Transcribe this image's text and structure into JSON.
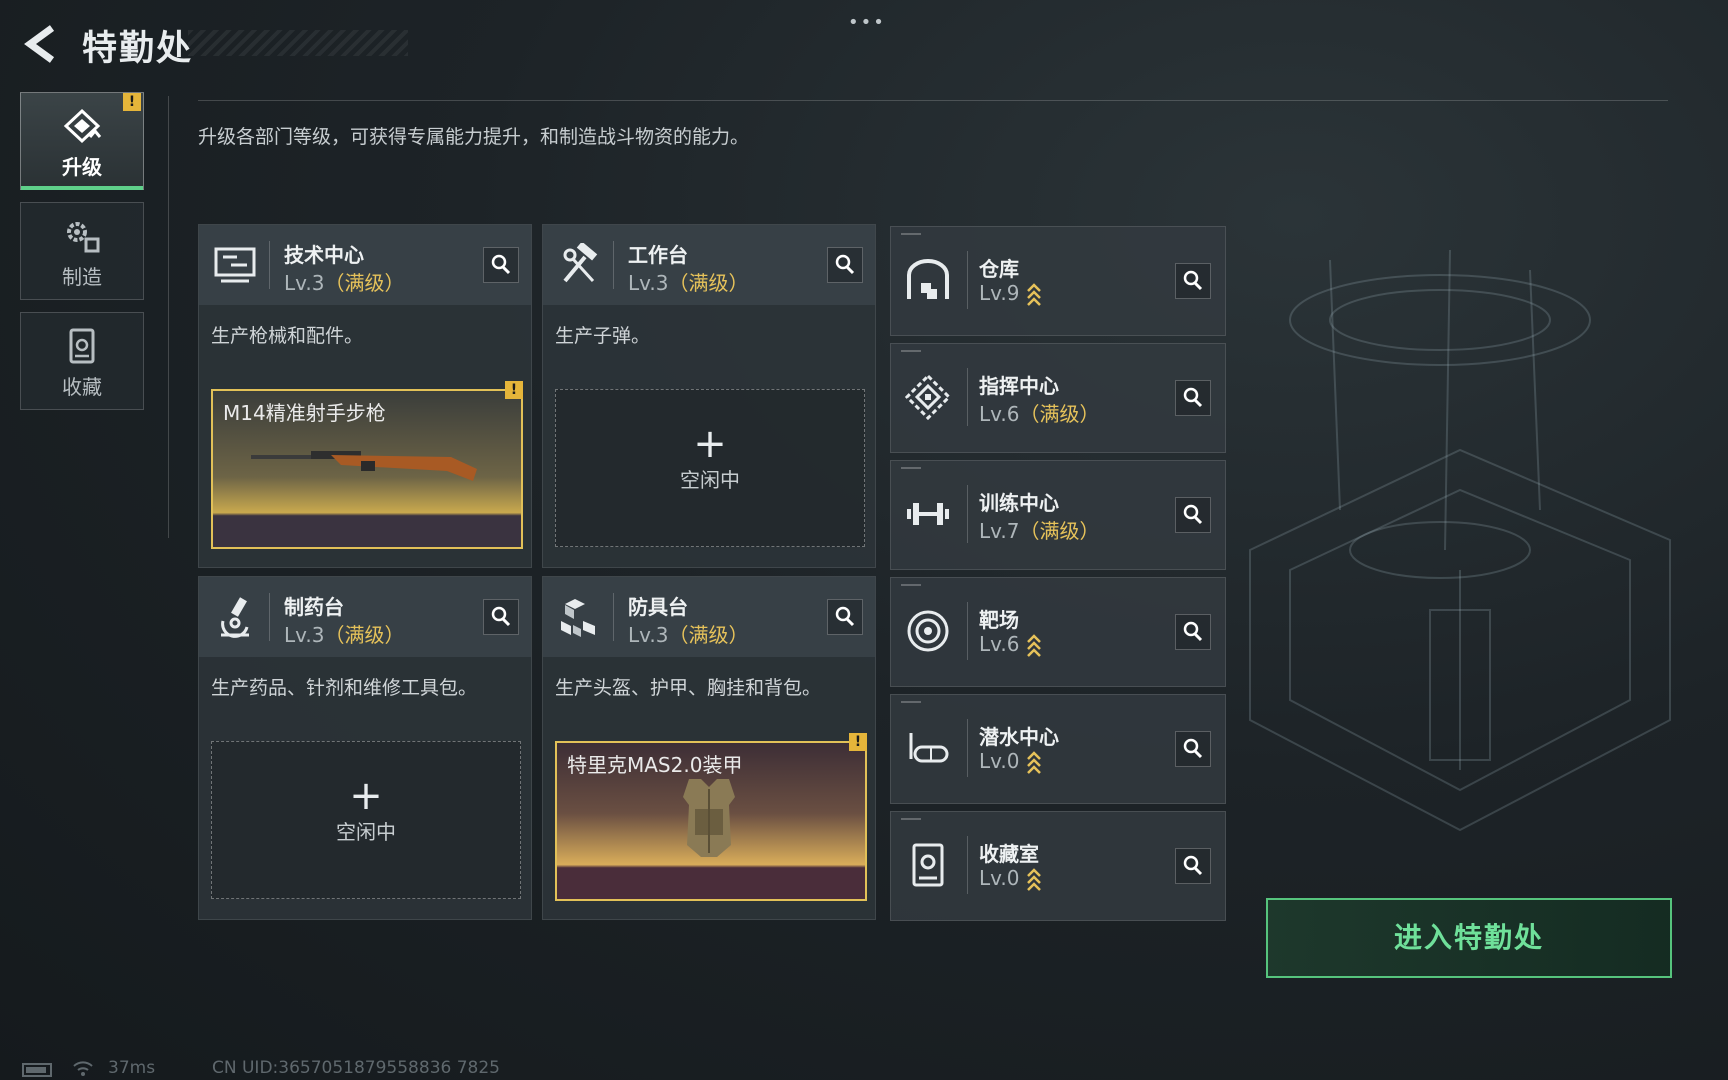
{
  "header": {
    "title": "特勤处",
    "more": "•••"
  },
  "description": "升级各部门等级，可获得专属能力提升，和制造战斗物资的能力。",
  "tabs": [
    {
      "label": "升级",
      "active": true,
      "badge": "!"
    },
    {
      "label": "制造",
      "active": false
    },
    {
      "label": "收藏",
      "active": false
    }
  ],
  "cards": [
    {
      "name": "技术中心",
      "level": "Lv.3",
      "max": "（满级）",
      "desc": "生产枪械和配件。",
      "slot": {
        "type": "item",
        "item_name": "M14精准射手步枪",
        "badge": "!"
      }
    },
    {
      "name": "工作台",
      "level": "Lv.3",
      "max": "（满级）",
      "desc": "生产子弹。",
      "slot": {
        "type": "empty",
        "plus": "+",
        "status": "空闲中"
      }
    },
    {
      "name": "制药台",
      "level": "Lv.3",
      "max": "（满级）",
      "desc": "生产药品、针剂和维修工具包。",
      "slot": {
        "type": "empty",
        "plus": "+",
        "status": "空闲中"
      }
    },
    {
      "name": "防具台",
      "level": "Lv.3",
      "max": "（满级）",
      "desc": "生产头盔、护甲、胸挂和背包。",
      "slot": {
        "type": "item",
        "item_name": "特里克MAS2.0装甲",
        "badge": "!"
      }
    }
  ],
  "facilities": [
    {
      "name": "仓库",
      "level": "Lv.9",
      "max": "",
      "upgradable": true
    },
    {
      "name": "指挥中心",
      "level": "Lv.6",
      "max": "（满级）",
      "upgradable": false
    },
    {
      "name": "训练中心",
      "level": "Lv.7",
      "max": "（满级）",
      "upgradable": false
    },
    {
      "name": "靶场",
      "level": "Lv.6",
      "max": "",
      "upgradable": true
    },
    {
      "name": "潜水中心",
      "level": "Lv.0",
      "max": "",
      "upgradable": true
    },
    {
      "name": "收藏室",
      "level": "Lv.0",
      "max": "",
      "upgradable": true
    }
  ],
  "enter_button": "进入特勤处",
  "status_bar": {
    "ping": "37ms",
    "uid": "CN UID:3657051879558836 7825"
  },
  "colors": {
    "accent_green": "#5fd08a",
    "max_gold": "#e6c25a",
    "warning": "#e5b53a"
  }
}
